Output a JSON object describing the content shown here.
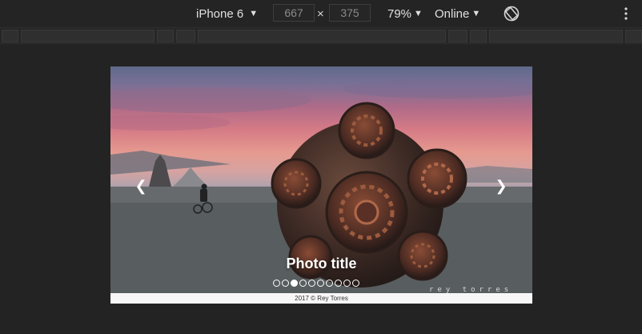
{
  "toolbar": {
    "device": "iPhone 6",
    "width_value": "667",
    "height_value": "375",
    "separator": "×",
    "zoom": "79%",
    "network": "Online"
  },
  "slideshow": {
    "title": "Photo title",
    "watermark": "rey torres",
    "caption": "2017 © Rey Torres",
    "slide_count": 10,
    "active_index": 2,
    "prev_icon": "chevron-left-icon",
    "next_icon": "chevron-right-icon"
  },
  "colors": {
    "page_background": "#232323",
    "toolbar_text": "#e0e0e0",
    "accent_white": "#ffffff"
  }
}
